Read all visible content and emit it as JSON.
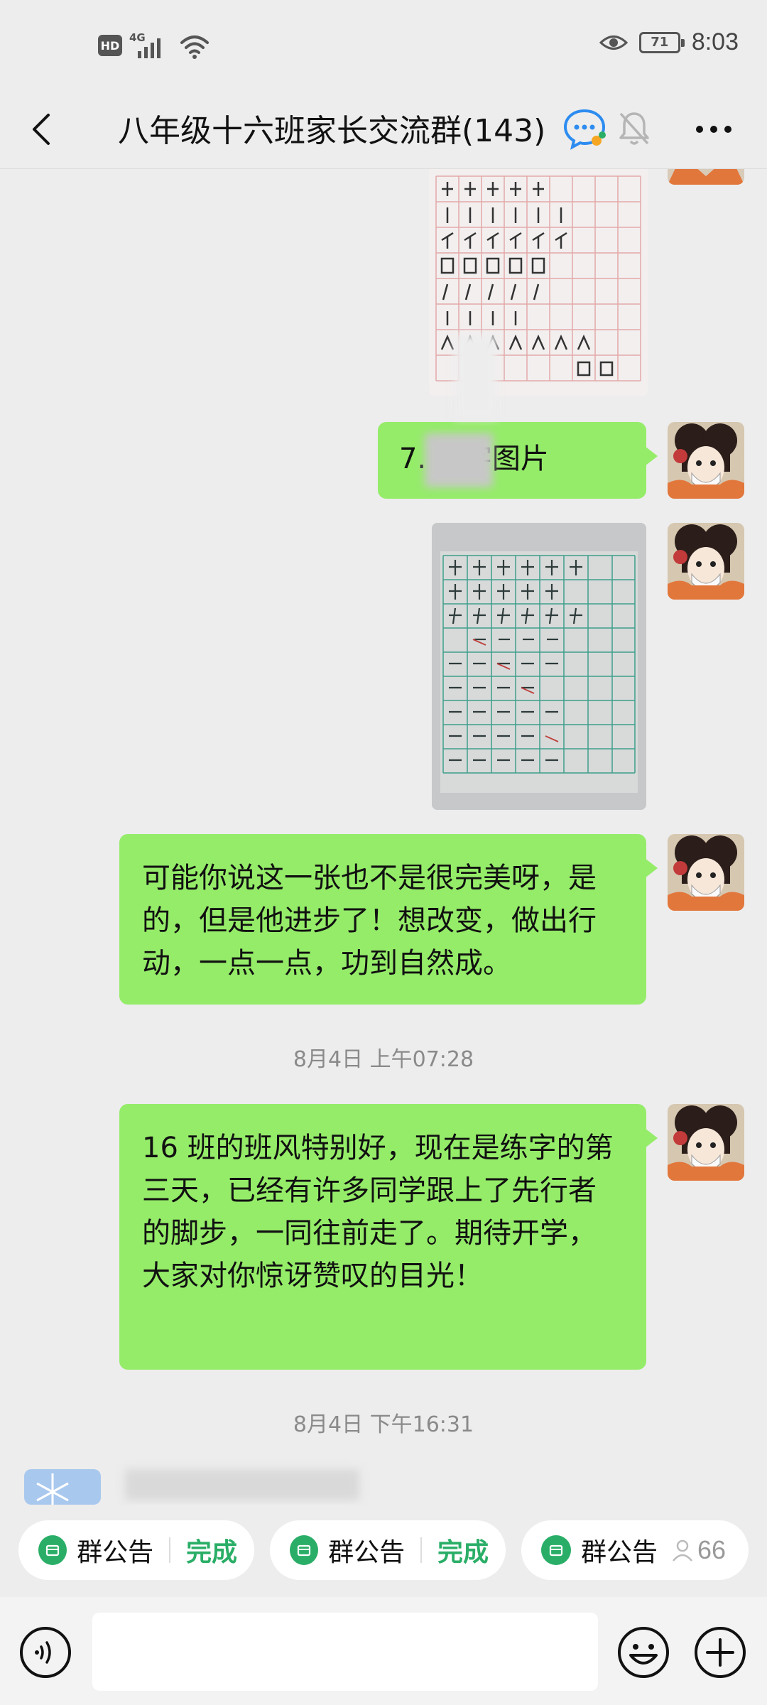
{
  "status_bar": {
    "hd_badge": "HD",
    "network_label": "4G",
    "battery_level": "71",
    "time": "8:03"
  },
  "nav": {
    "title": "八年级十六班家长交流群(143)"
  },
  "messages": [
    {
      "type": "image",
      "description_icon": "handwriting-practice-sheet-1"
    },
    {
      "type": "text",
      "text": "7.       练字图片"
    },
    {
      "type": "image",
      "description_icon": "handwriting-practice-sheet-2"
    },
    {
      "type": "text",
      "text": "可能你说这一张也不是很完美呀，是的，但是他进步了！想改变，做出行动，一点一点，功到自然成。"
    },
    {
      "type": "time",
      "text": "8月4日 上午07:28"
    },
    {
      "type": "text",
      "text": "16 班的班风特别好，现在是练字的第三天，已经有许多同学跟上了先行者的脚步，一同往前走了。期待开学，大家对你惊讶赞叹的目光！"
    },
    {
      "type": "time",
      "text": "8月4日 下午16:31"
    }
  ],
  "announcements": [
    {
      "label": "群公告",
      "status": "完成"
    },
    {
      "label": "群公告",
      "status": "完成"
    },
    {
      "label": "群公告",
      "count": "66"
    }
  ],
  "colors": {
    "bubble_green": "#95ec69",
    "accent_green": "#2aae67",
    "background": "#ededed"
  }
}
